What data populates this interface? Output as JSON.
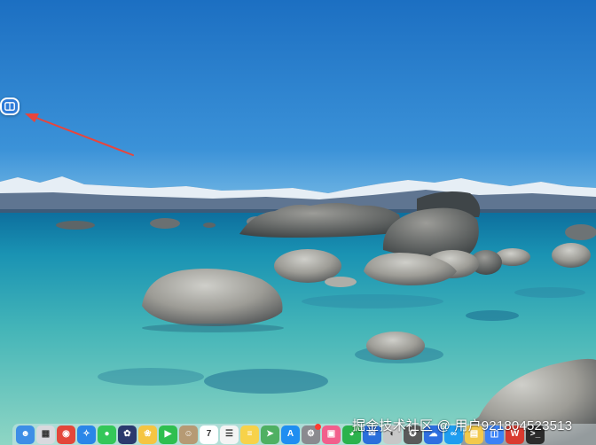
{
  "desktop": {
    "wallpaper": {
      "subject": "lake-with-boulders-and-snowy-mountains",
      "colors": {
        "sky_top": "#1c78c9",
        "sky_horizon": "#7cbde6",
        "water_far": "#1d8fb0",
        "water_near": "#7ad0c0",
        "rock": "#8e8d88"
      }
    },
    "floating_button": {
      "icon": "sidebar-panel-icon",
      "color": "#2f7bd8"
    },
    "annotation": {
      "type": "arrow",
      "color": "#e8453c"
    }
  },
  "dock": {
    "items": [
      {
        "name": "finder",
        "icon": "finder-icon",
        "color": "#3d8ee6",
        "glyph": "☻"
      },
      {
        "name": "launchpad",
        "icon": "launchpad-icon",
        "color": "#d9d9de",
        "glyph": "▦"
      },
      {
        "name": "chrome",
        "icon": "chrome-icon",
        "color": "#e3473a",
        "glyph": "◉"
      },
      {
        "name": "safari",
        "icon": "safari-icon",
        "color": "#2a86e8",
        "glyph": "✧"
      },
      {
        "name": "messages",
        "icon": "messages-icon",
        "color": "#34c759",
        "glyph": "●"
      },
      {
        "name": "design-app",
        "icon": "design-app-icon",
        "color": "#2b3a6e",
        "glyph": "✿"
      },
      {
        "name": "photos",
        "icon": "photos-icon",
        "color": "#f5c542",
        "glyph": "❀"
      },
      {
        "name": "facetime",
        "icon": "facetime-icon",
        "color": "#2fbf4f",
        "glyph": "▶"
      },
      {
        "name": "contacts",
        "icon": "contacts-icon",
        "color": "#b69a74",
        "glyph": "☺"
      },
      {
        "name": "calendar",
        "icon": "calendar-icon",
        "color": "#ffffff",
        "glyph": "7",
        "text": "7"
      },
      {
        "name": "reminders",
        "icon": "reminders-icon",
        "color": "#f4f4f4",
        "glyph": "☰"
      },
      {
        "name": "notes",
        "icon": "notes-icon",
        "color": "#f7d24a",
        "glyph": "≡"
      },
      {
        "name": "maps",
        "icon": "maps-icon",
        "color": "#4fb062",
        "glyph": "➤"
      },
      {
        "name": "app-store",
        "icon": "app-store-icon",
        "color": "#1f8ef1",
        "glyph": "A"
      },
      {
        "name": "system-settings",
        "icon": "settings-icon",
        "color": "#8a8a8f",
        "glyph": "⚙",
        "badge": true
      },
      {
        "name": "video-app",
        "icon": "video-app-icon",
        "color": "#f25f8c",
        "glyph": "▣"
      },
      {
        "name": "wechat",
        "icon": "wechat-icon",
        "color": "#2bb24c",
        "glyph": "◕"
      },
      {
        "name": "mail-app",
        "icon": "mail-app-icon",
        "color": "#2a6fdb",
        "glyph": "✉"
      },
      {
        "name": "avatar-app",
        "icon": "avatar-app-icon",
        "color": "#c7c7c7",
        "glyph": "◐"
      },
      {
        "name": "panda-app",
        "icon": "panda-app-icon",
        "color": "#5a5a5a",
        "glyph": "✪"
      },
      {
        "name": "cloud-app",
        "icon": "cloud-app-icon",
        "color": "#2e6fe0",
        "glyph": "☁"
      },
      {
        "name": "vpn-app",
        "icon": "vpn-app-icon",
        "color": "#1e9df0",
        "glyph": "∞"
      },
      {
        "name": "notes-yellow",
        "icon": "memo-icon",
        "color": "#f2c94c",
        "glyph": "▤"
      },
      {
        "name": "sidebar-app",
        "icon": "sidebar-app-icon",
        "color": "#3b82f6",
        "glyph": "◫"
      },
      {
        "name": "wps",
        "icon": "wps-icon",
        "color": "#d93a2f",
        "glyph": "W"
      },
      {
        "name": "terminal",
        "icon": "terminal-icon",
        "color": "#2b2b2b",
        "glyph": ">_"
      }
    ]
  },
  "watermark": {
    "text": "掘金技术社区 @ 用户921804523513"
  }
}
